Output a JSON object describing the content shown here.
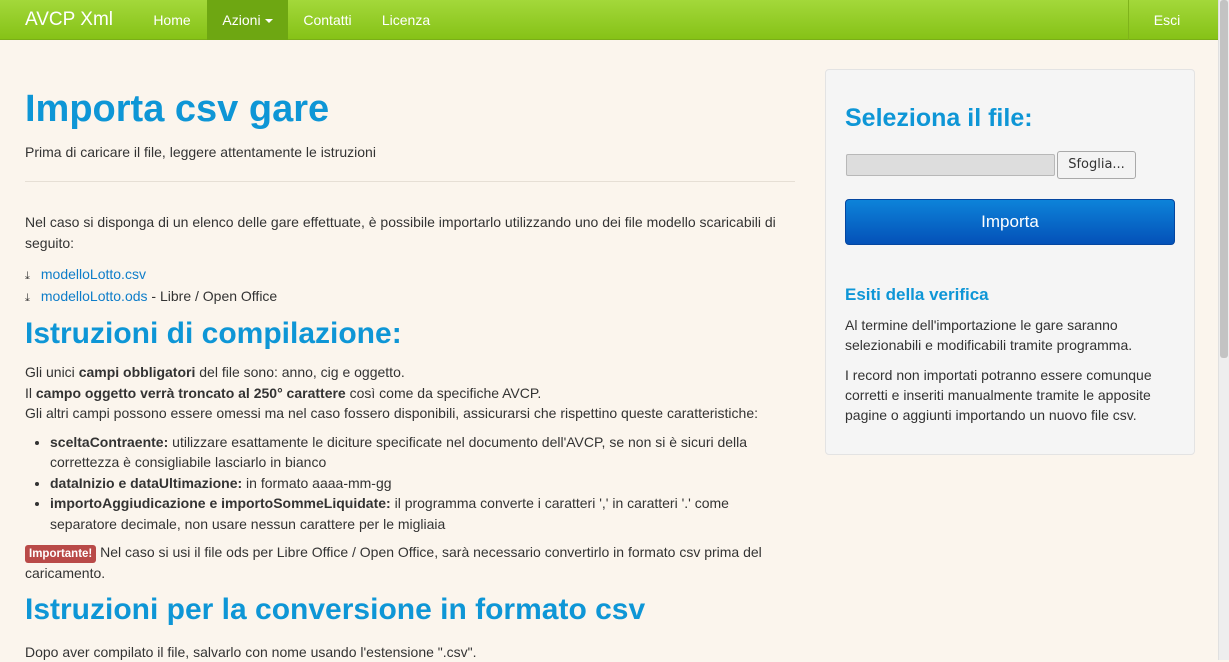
{
  "navbar": {
    "brand": "AVCP Xml",
    "items": [
      {
        "label": "Home"
      },
      {
        "label": "Azioni"
      },
      {
        "label": "Contatti"
      },
      {
        "label": "Licenza"
      }
    ],
    "logout": "Esci"
  },
  "main": {
    "title": "Importa csv gare",
    "subtitle": "Prima di caricare il file, leggere attentamente le istruzioni",
    "intro": "Nel caso si disponga di un elenco delle gare effettuate, è possibile importarlo utilizzando uno dei file modello scaricabili di seguito:",
    "downloads": [
      {
        "label": "modelloLotto.csv",
        "note": ""
      },
      {
        "label": "modelloLotto.ods",
        "note": " - Libre / Open Office"
      }
    ],
    "section1": {
      "title": "Istruzioni di compilazione:",
      "line1_pre": "Gli unici ",
      "line1_bold": "campi obbligatori",
      "line1_post": " del file sono: anno, cig e oggetto.",
      "line2_pre": "Il ",
      "line2_bold": "campo oggetto verrà troncato al 250° carattere",
      "line2_post": " così come da specifiche AVCP.",
      "line3": "Gli altri campi possono essere omessi ma nel caso fossero disponibili, assicurarsi che rispettino queste caratteristiche:",
      "fields": [
        {
          "name": "sceltaContraente:",
          "desc": " utilizzare esattamente le diciture specificate nel documento dell'AVCP, se non si è sicuri della correttezza è consigliabile lasciarlo in bianco"
        },
        {
          "name": "dataInizio e dataUltimazione:",
          "desc": " in formato aaaa-mm-gg"
        },
        {
          "name": "importoAggiudicazione e importoSommeLiquidate:",
          "desc": " il programma converte i caratteri ',' in caratteri '.' come separatore decimale, non usare nessun carattere per le migliaia"
        }
      ],
      "important_badge": "Importante!",
      "important_text": " Nel caso si usi il file ods per Libre Office / Open Office, sarà necessario convertirlo in formato csv prima del caricamento."
    },
    "section2": {
      "title": "Istruzioni per la conversione in formato csv",
      "text": "Dopo aver compilato il file, salvarlo con nome usando l'estensione \".csv\"."
    }
  },
  "sidebar": {
    "title": "Seleziona il file:",
    "browse_label": "Sfoglia...",
    "import_label": "Importa",
    "subtitle": "Esiti della verifica",
    "p1": "Al termine dell'importazione le gare saranno selezionabili e modificabili tramite programma.",
    "p2": "I record non importati potranno essere comunque corretti e inseriti manualmente tramite le apposite pagine o aggiunti importando un nuovo file csv."
  },
  "colors": {
    "navbar": "#8cc620",
    "heading": "#0e96d6",
    "link": "#0e7dc9",
    "primary_button": "#0a6bcc",
    "badge": "#b94a48",
    "background": "#fbf5ed"
  }
}
